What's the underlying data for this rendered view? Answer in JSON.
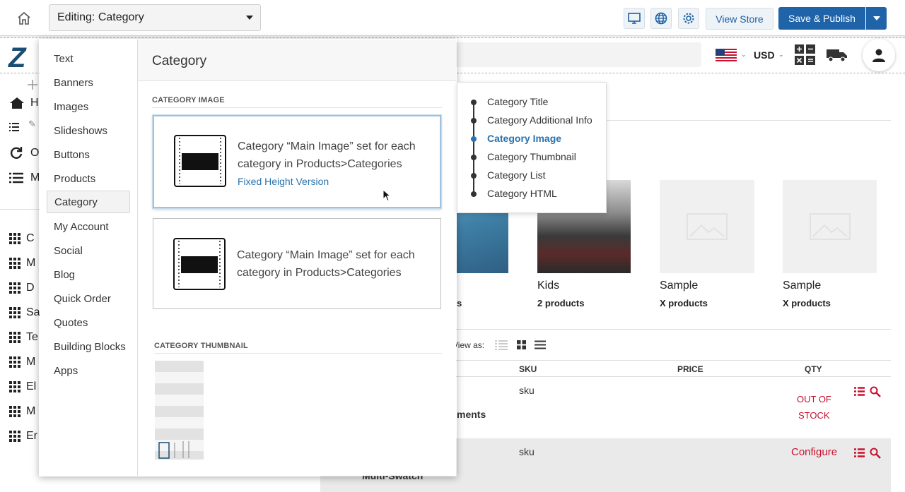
{
  "topbar": {
    "editing_label": "Editing: Category",
    "view_store": "View Store",
    "save_publish": "Save & Publish"
  },
  "store": {
    "currency": "USD",
    "left_nav": [
      {
        "label": "H",
        "icon": "home-icon"
      },
      {
        "label": "O",
        "icon": "refresh-icon"
      },
      {
        "label": "M",
        "icon": "list-icon"
      },
      {
        "label": "C",
        "icon": "grid-icon"
      },
      {
        "label": "M",
        "icon": "grid-icon"
      },
      {
        "label": "D",
        "icon": "grid-icon"
      },
      {
        "label": "Sa",
        "icon": "grid-icon"
      },
      {
        "label": "Te",
        "icon": "grid-icon"
      },
      {
        "label": "M",
        "icon": "grid-icon"
      },
      {
        "label": "El",
        "icon": "grid-icon"
      },
      {
        "label": "M",
        "icon": "grid-icon"
      },
      {
        "label": "Er",
        "icon": "grid-icon"
      }
    ],
    "categories": [
      {
        "name": "Kids",
        "count": "2 products"
      },
      {
        "name": "Sample",
        "count": "X products"
      },
      {
        "name": "Sample",
        "count": "X products"
      }
    ],
    "partial_count_suffix": "s",
    "view_as": "View as:",
    "table_headers": {
      "sku": "SKU",
      "price": "PRICE",
      "qty": "QTY"
    },
    "rows": [
      {
        "sku": "sku",
        "name_fragment": "ments",
        "qty_line1": "OUT OF",
        "qty_line2": "STOCK"
      },
      {
        "sku": "sku",
        "name_fragment": "Multi-Swatch",
        "qty_action": "Configure"
      }
    ]
  },
  "panel": {
    "menu": [
      "Text",
      "Banners",
      "Images",
      "Slideshows",
      "Buttons",
      "Products",
      "Category",
      "My Account",
      "Social",
      "Blog",
      "Quick Order",
      "Quotes",
      "Building Blocks",
      "Apps"
    ],
    "active_menu": "Category",
    "title": "Category",
    "section_image": "CATEGORY IMAGE",
    "section_thumbnail": "CATEGORY THUMBNAIL",
    "option1_line1": "Category “Main Image” set for each",
    "option1_line2": "category in Products>Categories",
    "option1_link": "Fixed Height Version",
    "option2_line1": "Category “Main Image” set for each",
    "option2_line2": "category in Products>Categories"
  },
  "submenu": {
    "items": [
      "Category Title",
      "Category Additional Info",
      "Category Image",
      "Category Thumbnail",
      "Category List",
      "Category HTML"
    ],
    "active": "Category Image"
  },
  "colors": {
    "accent": "#1f63a8",
    "link": "#2a73ae",
    "alert": "#c8102e"
  }
}
